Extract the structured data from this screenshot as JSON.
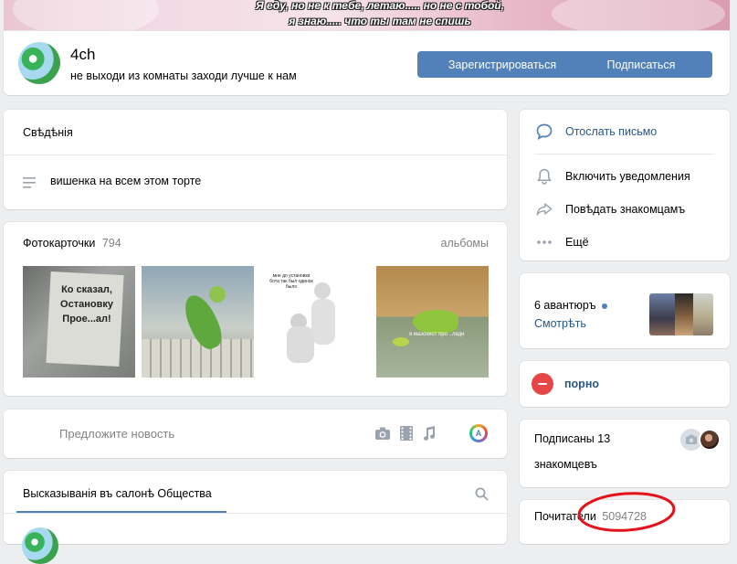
{
  "cover": {
    "line1": "Я еду, но не к тебе, летаю..... но не с тобой,",
    "line2": "я знаю..... что ты там не спишь"
  },
  "header": {
    "name": "4ch",
    "status": "не выходи из комнаты заходи лучше к нам",
    "register_label": "Зарегистрироваться",
    "subscribe_label": "Подписаться"
  },
  "info": {
    "title": "Свѣдѣнія",
    "description": "вишенка на всем этом торте"
  },
  "photos": {
    "title": "Фотокарточки",
    "count": "794",
    "albums_label": "альбомы",
    "items": [
      {
        "caption": "Ко сказал, Остановку Прое...ал!"
      },
      {
        "caption": ""
      },
      {
        "caption": "мне до установки бота так был одинок было"
      },
      {
        "caption": "я мазохист про ..леди"
      }
    ]
  },
  "suggest": {
    "placeholder": "Предложите новость"
  },
  "wall": {
    "tab_label": "Высказыванія въ салонѣ Общества"
  },
  "actions": {
    "send_message": "Отослать письмо",
    "notifications": "Включить уведомления",
    "tell_friends": "Повѣдать знакомцамъ",
    "more": "Ещё"
  },
  "events": {
    "title": "6 авантюръ",
    "link": "Смотрѣть"
  },
  "tag": {
    "label": "порно"
  },
  "subscriptions": {
    "title": "Подписаны 13",
    "sub": "знакомцевъ"
  },
  "followers": {
    "label": "Почитатели",
    "count": "5094728"
  },
  "colors": {
    "accent": "#5181b8",
    "link": "#2a5885",
    "annotation": "#e3121b",
    "tag_icon": "#e64646"
  }
}
